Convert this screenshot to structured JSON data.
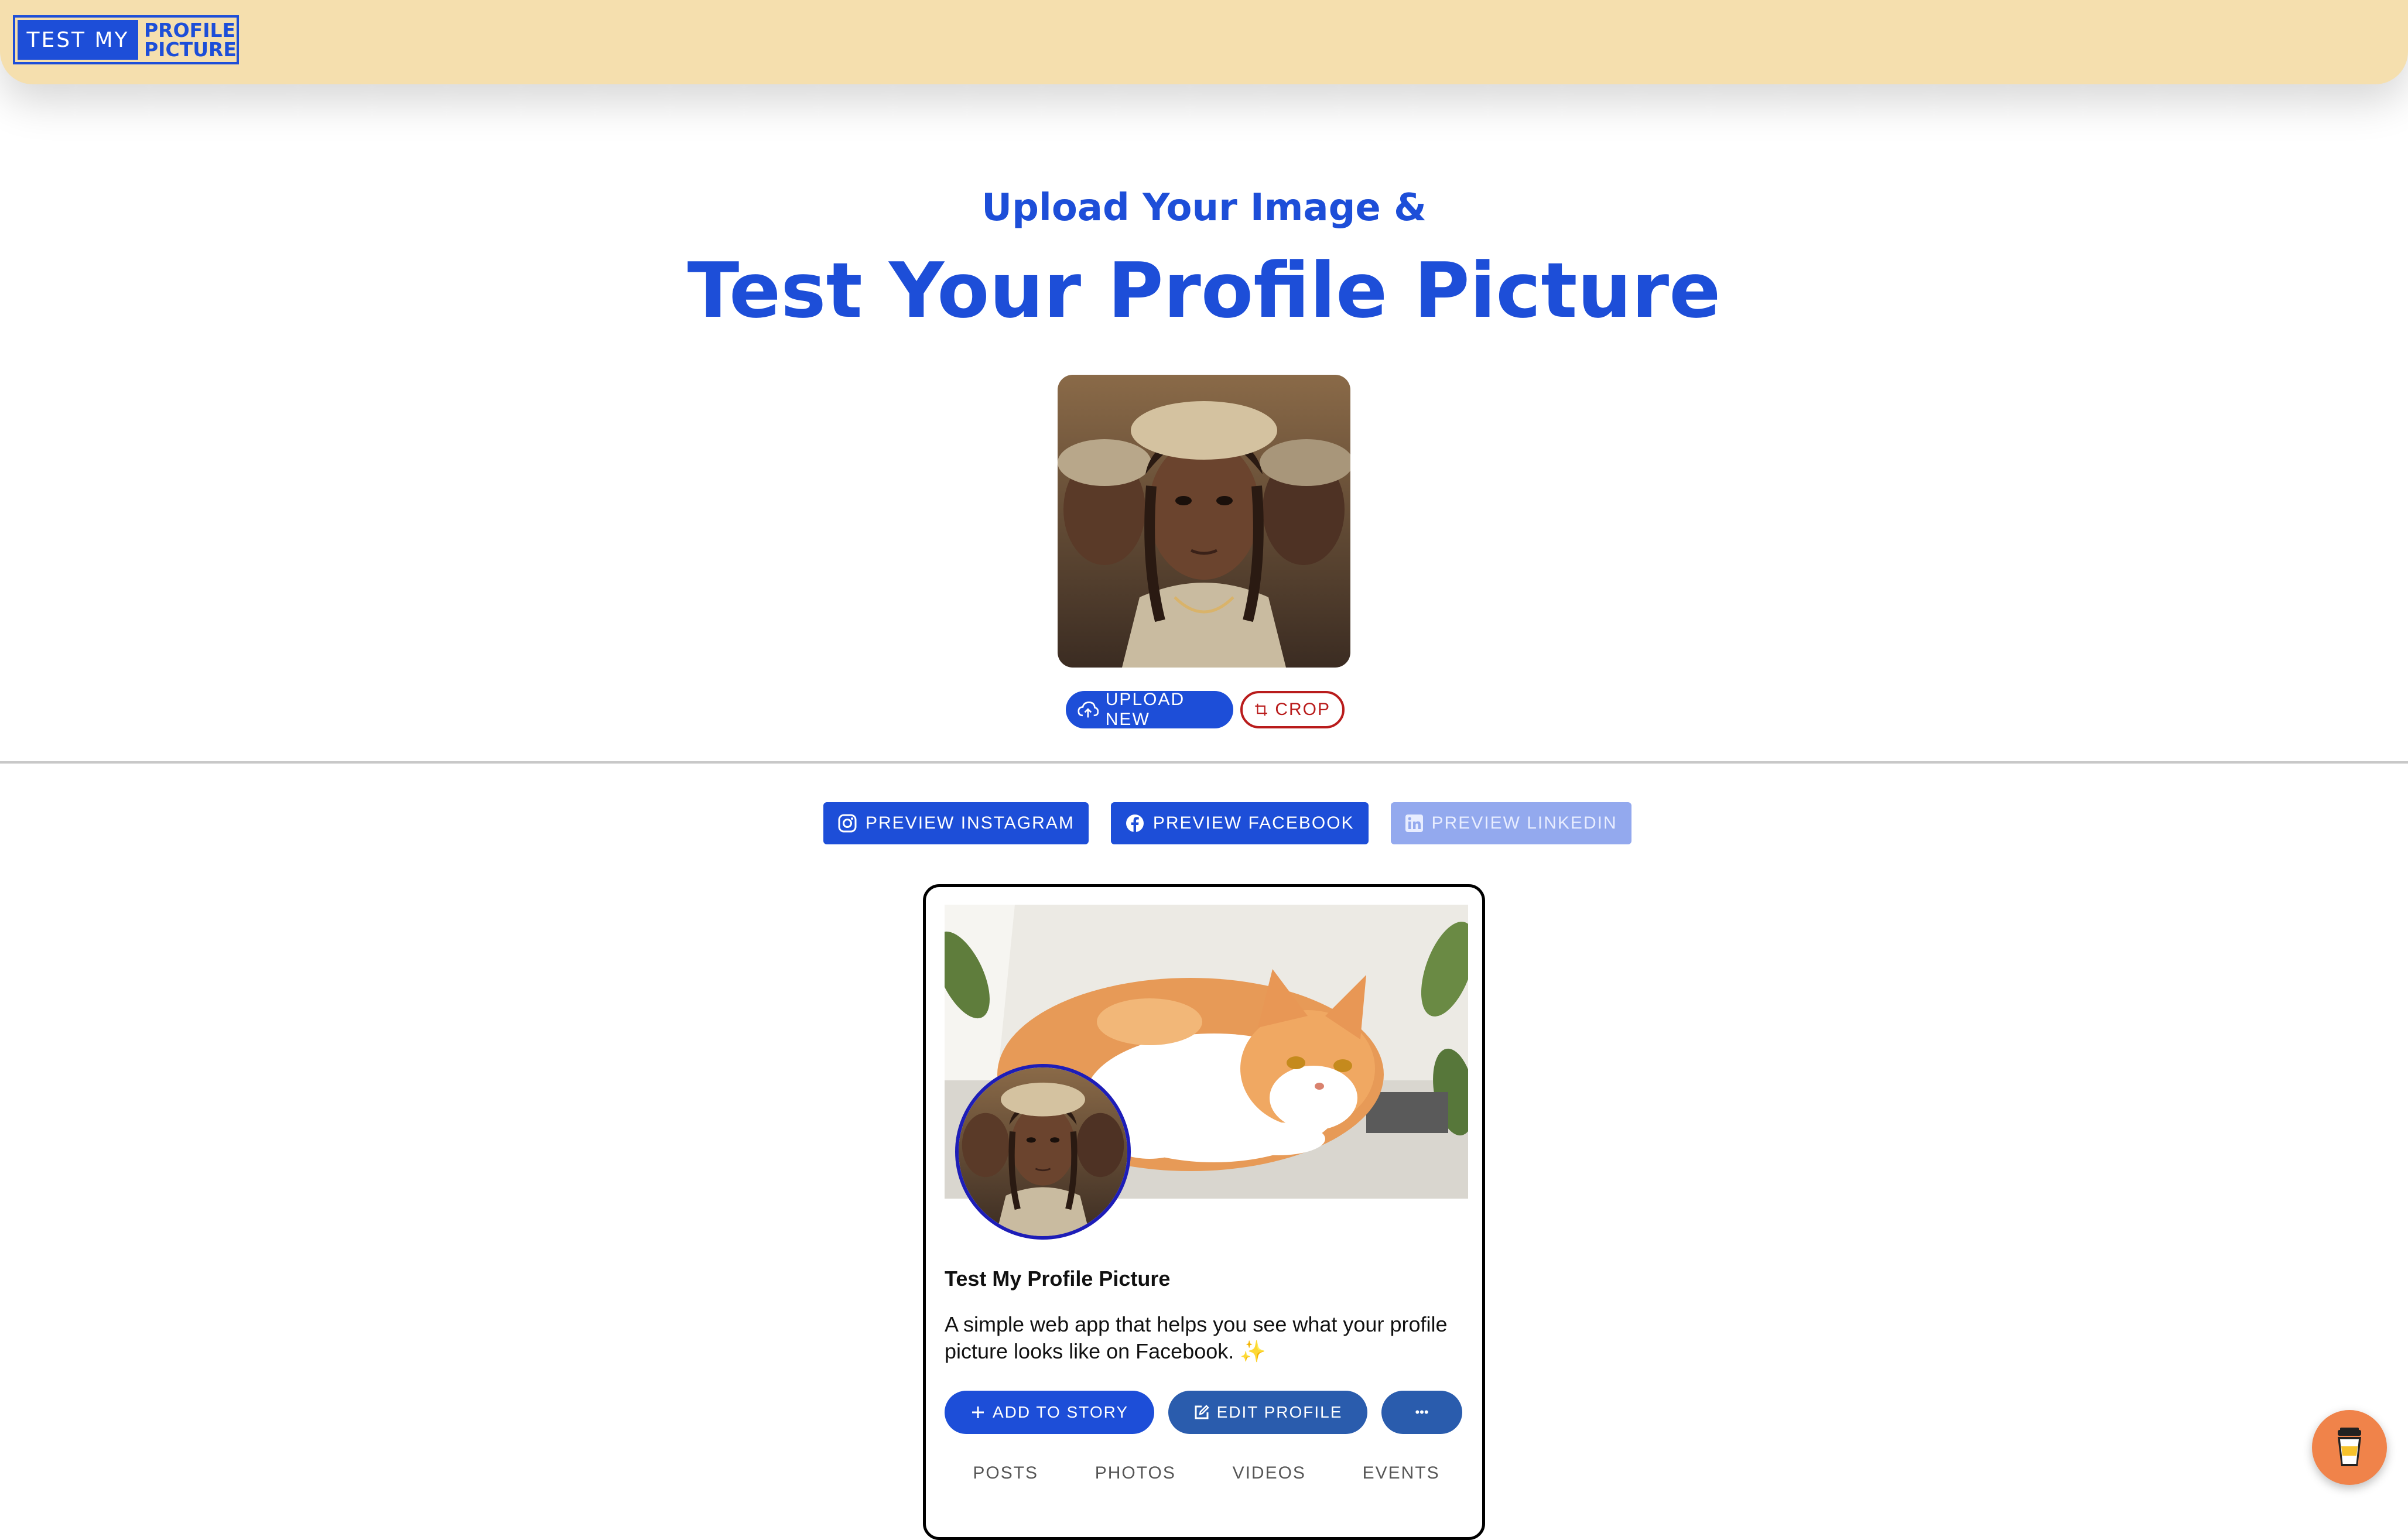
{
  "logo": {
    "part1": "TEST MY",
    "line1": "PROFILE",
    "line2": "PICTURE"
  },
  "hero": {
    "subtitle": "Upload Your Image &",
    "title": "Test Your Profile Picture"
  },
  "image_actions": {
    "upload": "UPLOAD NEW",
    "crop": "CROP"
  },
  "preview_tabs": [
    {
      "label": "PREVIEW INSTAGRAM",
      "icon": "instagram-icon",
      "disabled": false
    },
    {
      "label": "PREVIEW FACEBOOK",
      "icon": "facebook-icon",
      "disabled": false
    },
    {
      "label": "PREVIEW LINKEDIN",
      "icon": "linkedin-icon",
      "disabled": true
    }
  ],
  "facebook_preview": {
    "name": "Test My Profile Picture",
    "bio": "A simple web app that helps you see what your profile picture looks like on Facebook.",
    "sparkle": "✨",
    "actions": {
      "add_story": "ADD TO STORY",
      "edit_profile": "EDIT PROFILE",
      "more": "•••"
    },
    "tabs": [
      "POSTS",
      "PHOTOS",
      "VIDEOS",
      "EVENTS"
    ]
  },
  "colors": {
    "brand_blue": "#1d4ed8",
    "header_bg": "#f5dfae",
    "crop_red": "#b91c1c",
    "coffee_orange": "#f0834a"
  }
}
